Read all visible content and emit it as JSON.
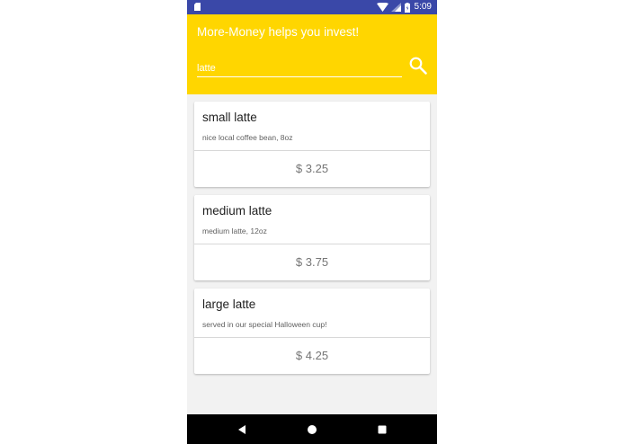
{
  "status_bar": {
    "time": "5:09"
  },
  "app_bar": {
    "title": "More-Money helps you invest!",
    "search_value": "latte",
    "search_placeholder": ""
  },
  "items": [
    {
      "title": "small latte",
      "description": "nice local coffee bean, 8oz",
      "price": "$ 3.25"
    },
    {
      "title": "medium latte",
      "description": "medium latte, 12oz",
      "price": "$ 3.75"
    },
    {
      "title": "large latte",
      "description": "served in our special Halloween cup!",
      "price": "$ 4.25"
    }
  ],
  "colors": {
    "status_bar": "#3a48a8",
    "app_bar": "#ffd600",
    "background": "#f2f2f2"
  },
  "icons": {
    "search": "search-icon",
    "back": "back-triangle-icon",
    "home": "home-circle-icon",
    "recents": "recents-square-icon"
  }
}
